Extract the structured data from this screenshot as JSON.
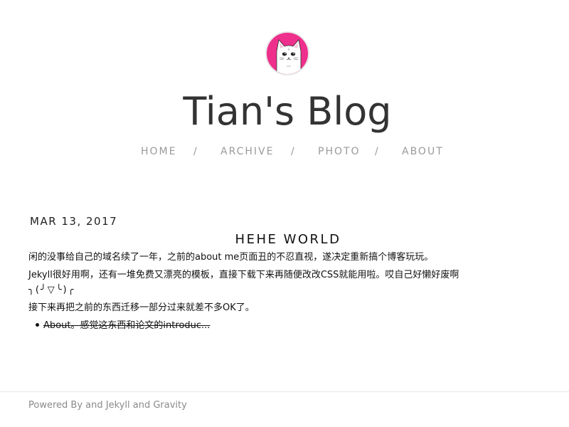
{
  "header": {
    "avatar": {
      "icon": "cat-avatar-icon",
      "bg_color": "#ee2f8b"
    },
    "title": "Tian's Blog"
  },
  "nav": {
    "items": [
      {
        "label": "HOME"
      },
      {
        "label": "ARCHIVE"
      },
      {
        "label": "PHOTO"
      },
      {
        "label": "ABOUT"
      }
    ],
    "separator": "/"
  },
  "post": {
    "date": "MAR 13, 2017",
    "title": "HEHE WORLD",
    "paragraphs": [
      "闲的没事给自己的域名续了一年，之前的about me页面丑的不忍直视，遂决定重新搞个博客玩玩。",
      "Jekyll很好用啊，还有一堆免费又漂亮的模板，直接下载下来再随便改改CSS就能用啦。哎自己好懒好废啊",
      "╮(╯▽╰)╭",
      "接下来再把之前的东西迁移一部分过来就差不多OK了。"
    ],
    "list": [
      {
        "text": "About。感觉这东西和论文的introduc..."
      }
    ]
  },
  "footer": {
    "powered": "Powered By",
    "and1": "and",
    "jekyll": "Jekyll",
    "and2": "and",
    "gravity": "Gravity"
  }
}
